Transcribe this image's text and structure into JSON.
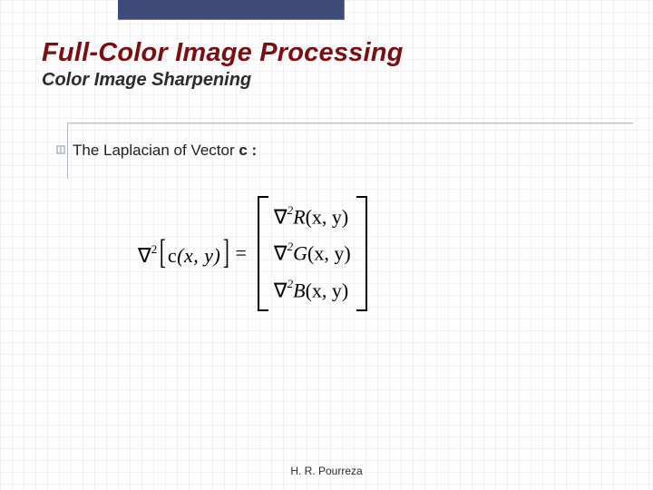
{
  "header": {
    "title": "Full-Color Image Processing",
    "subtitle": "Color Image Sharpening"
  },
  "body": {
    "lead_pre": "The Laplacian of Vector ",
    "lead_vec": "c :"
  },
  "formula": {
    "lhs_nabla": "∇",
    "lhs_sup": "2",
    "lhs_inner_c": "c",
    "lhs_inner_args": "(x, y)",
    "eq": "=",
    "rows": {
      "r1_nabla": "∇",
      "r1_sup": "2",
      "r1_fn": "R",
      "r1_args": "(x, y)",
      "r2_nabla": "∇",
      "r2_sup": "2",
      "r2_fn": "G",
      "r2_args": "(x, y)",
      "r3_nabla": "∇",
      "r3_sup": "2",
      "r3_fn": "B",
      "r3_args": "(x, y)"
    }
  },
  "footer": {
    "author": "H. R. Pourreza"
  }
}
